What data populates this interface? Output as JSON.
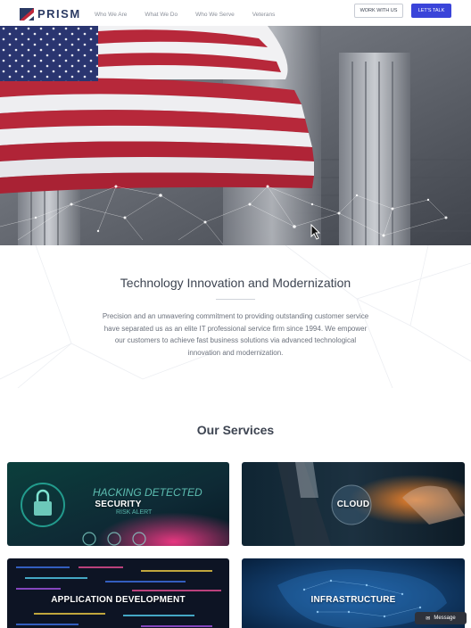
{
  "brand": {
    "name": "PRISM"
  },
  "nav": {
    "links": [
      "Who We Are",
      "What We Do",
      "Who We Serve",
      "Veterans"
    ],
    "work_with_us": "WORK WITH US",
    "lets_talk": "LET'S TALK"
  },
  "intro": {
    "title": "Technology Innovation and Modernization",
    "body": "Precision and an unwavering commitment to providing outstanding customer service have separated us as an elite IT professional service firm since 1994. We empower our customers to achieve fast business solutions via advanced technological innovation and modernization."
  },
  "services": {
    "title": "Our Services",
    "cards": [
      {
        "label": "SECURITY",
        "overlay_text": "HACKING DETECTED",
        "overlay_sub": "RISK ALERT"
      },
      {
        "label": "CLOUD"
      },
      {
        "label": "APPLICATION DEVELOPMENT"
      },
      {
        "label": "INFRASTRUCTURE"
      }
    ]
  },
  "chat": {
    "label": "Message"
  },
  "colors": {
    "accent": "#3a44d9",
    "brand": "#2b3a63",
    "flag_red": "#b7283a",
    "flag_blue": "#2a3570"
  }
}
